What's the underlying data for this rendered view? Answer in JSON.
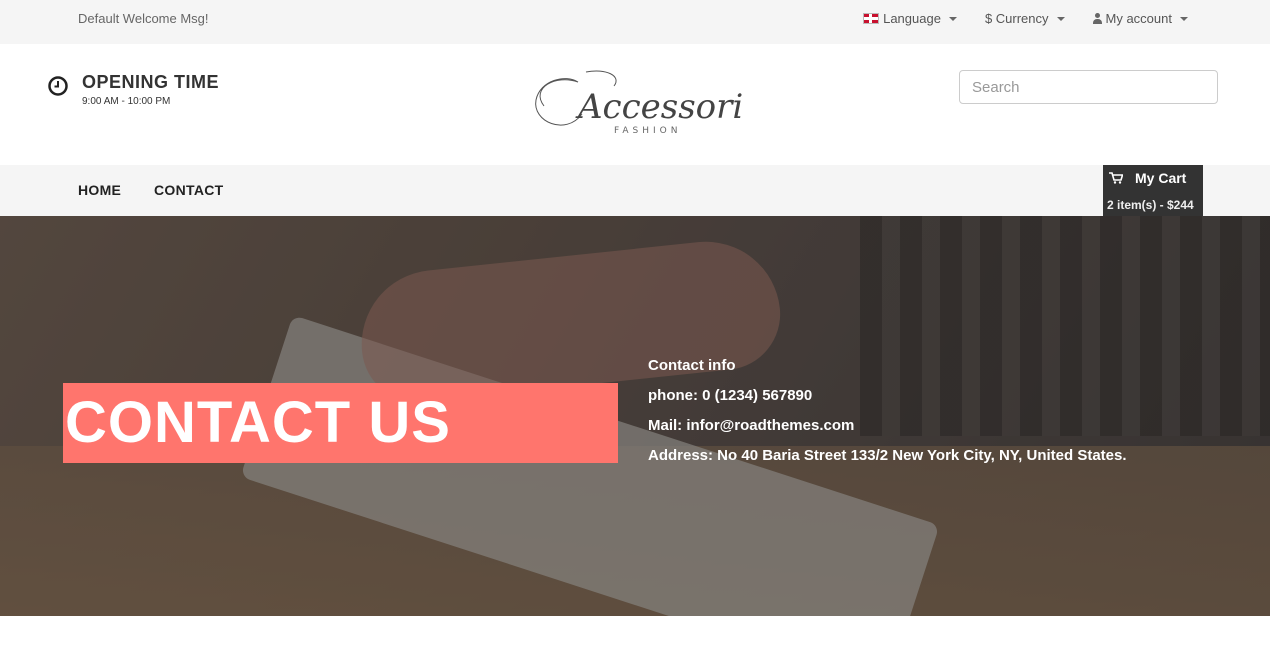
{
  "topbar": {
    "welcome": "Default Welcome Msg!",
    "language_label": "Language",
    "currency_label": "$ Currency",
    "account_label": "My account"
  },
  "header": {
    "opening_title": "OPENING TIME",
    "opening_hours": "9:00 AM - 10:00 PM",
    "logo_main": "Accessories",
    "logo_sub": "FASHION",
    "search_placeholder": "Search"
  },
  "nav": {
    "items": [
      {
        "label": "HOME"
      },
      {
        "label": "CONTACT"
      }
    ]
  },
  "cart": {
    "label": "My Cart",
    "summary": "2 item(s) - $244"
  },
  "hero": {
    "title": "CONTACT US",
    "info_heading": "Contact info",
    "phone": "phone: 0 (1234) 567890",
    "mail": "Mail: infor@roadthemes.com",
    "address": "Address: No 40 Baria Street 133/2 New York City, NY, United States."
  },
  "colors": {
    "accent": "#ff756d",
    "cart_bg": "#333333",
    "bar_bg": "#f5f5f5"
  },
  "icons": [
    "uk-flag-icon",
    "caret-down-icon",
    "user-icon",
    "clock-icon",
    "cart-icon"
  ]
}
